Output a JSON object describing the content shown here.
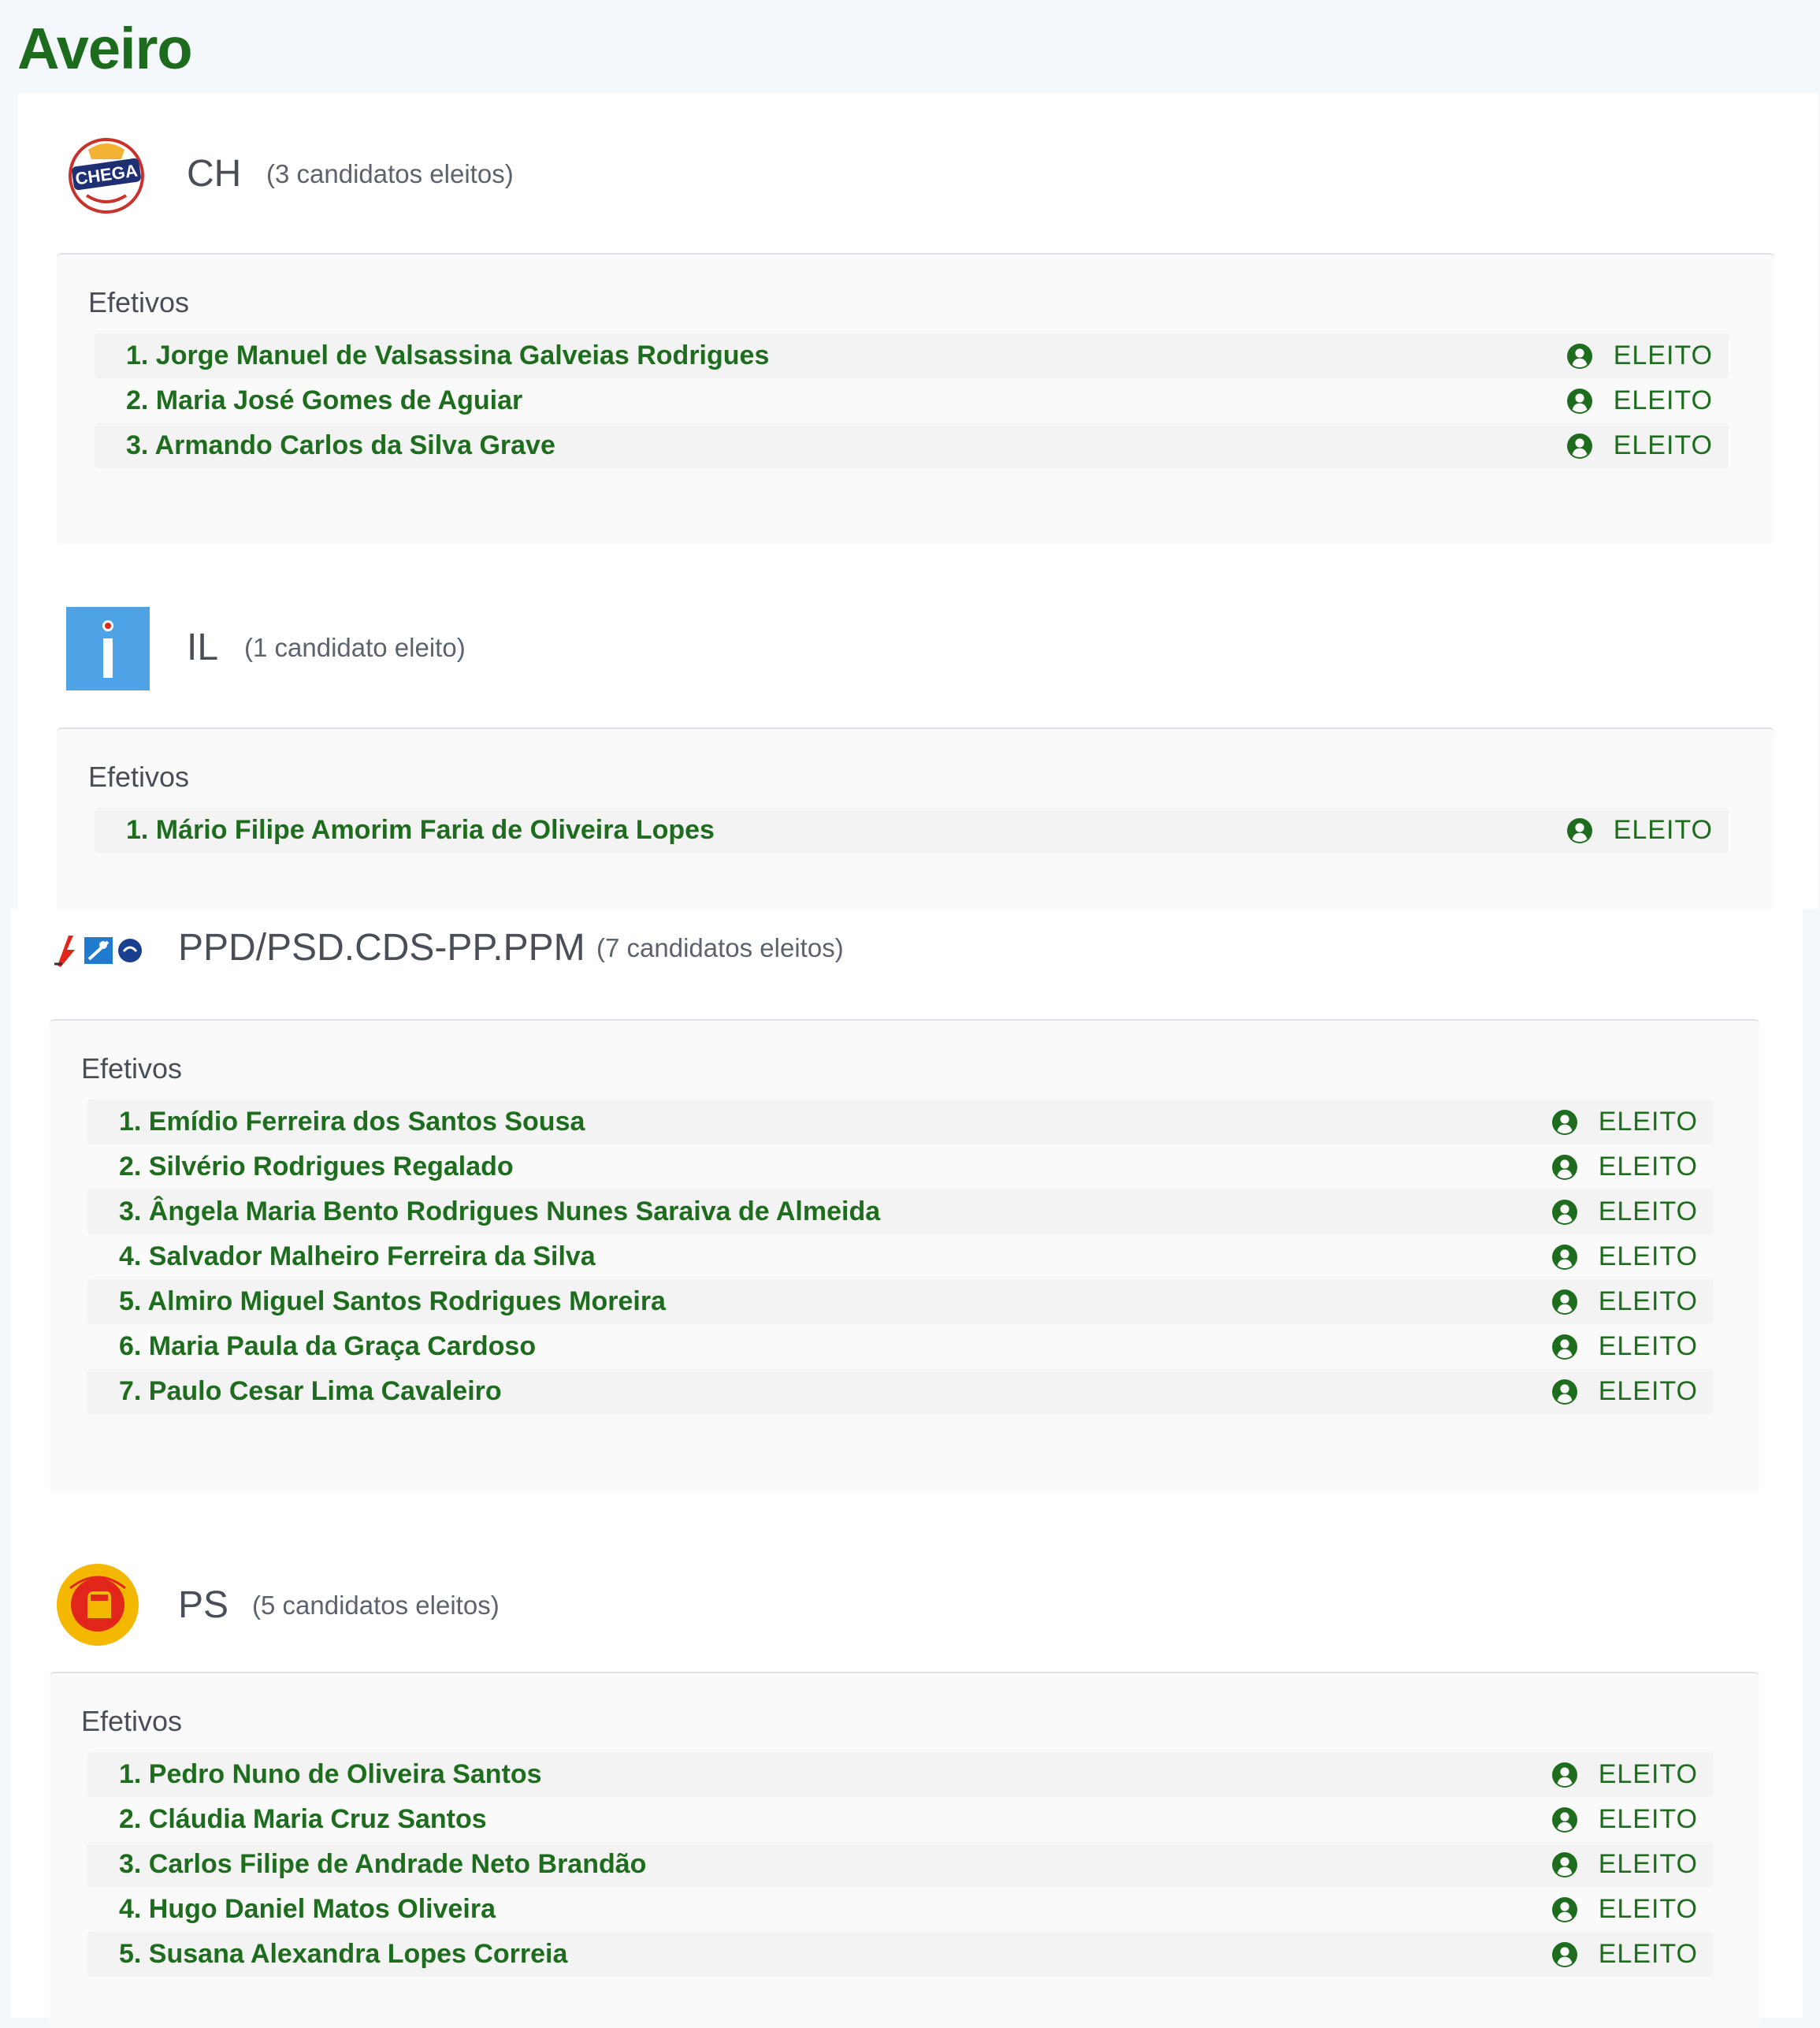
{
  "page": {
    "title": "Aveiro"
  },
  "colors": {
    "accent_green": "#1d6b1d",
    "status_green": "#1e6d1e",
    "il_blue": "#4da3e6",
    "ps_yellow": "#f5b800",
    "ps_red": "#e3261b"
  },
  "parties": [
    {
      "logo": "chega-logo",
      "name": "CH",
      "count": "(3 candidatos eleitos)",
      "section": "Efetivos",
      "candidates": [
        {
          "name": "1. Jorge Manuel de Valsassina Galveias Rodrigues",
          "status": "ELEITO"
        },
        {
          "name": "2. Maria José Gomes de Aguiar",
          "status": "ELEITO"
        },
        {
          "name": "3. Armando Carlos da Silva Grave",
          "status": "ELEITO"
        }
      ]
    },
    {
      "logo": "iniciativa-liberal-logo",
      "name": "IL",
      "count": "(1 candidato eleito)",
      "section": "Efetivos",
      "candidates": [
        {
          "name": "1. Mário Filipe Amorim Faria de Oliveira Lopes",
          "status": "ELEITO"
        }
      ]
    },
    {
      "logo": "ad-coalition-logo",
      "name": "PPD/PSD.CDS-PP.PPM",
      "count": "(7 candidatos eleitos)",
      "section": "Efetivos",
      "candidates": [
        {
          "name": "1. Emídio Ferreira dos Santos Sousa",
          "status": "ELEITO"
        },
        {
          "name": "2. Silvério Rodrigues Regalado",
          "status": "ELEITO"
        },
        {
          "name": "3. Ângela Maria Bento Rodrigues Nunes Saraiva de Almeida",
          "status": "ELEITO"
        },
        {
          "name": "4. Salvador Malheiro Ferreira da Silva",
          "status": "ELEITO"
        },
        {
          "name": "5. Almiro Miguel Santos Rodrigues Moreira",
          "status": "ELEITO"
        },
        {
          "name": "6. Maria Paula da Graça Cardoso",
          "status": "ELEITO"
        },
        {
          "name": "7. Paulo Cesar Lima Cavaleiro",
          "status": "ELEITO"
        }
      ]
    },
    {
      "logo": "partido-socialista-logo",
      "name": "PS",
      "count": "(5 candidatos eleitos)",
      "section": "Efetivos",
      "candidates": [
        {
          "name": "1. Pedro Nuno de Oliveira Santos",
          "status": "ELEITO"
        },
        {
          "name": "2. Cláudia Maria Cruz Santos",
          "status": "ELEITO"
        },
        {
          "name": "3. Carlos Filipe de Andrade Neto Brandão",
          "status": "ELEITO"
        },
        {
          "name": "4. Hugo Daniel Matos Oliveira",
          "status": "ELEITO"
        },
        {
          "name": "5. Susana Alexandra Lopes Correia",
          "status": "ELEITO"
        }
      ]
    }
  ]
}
